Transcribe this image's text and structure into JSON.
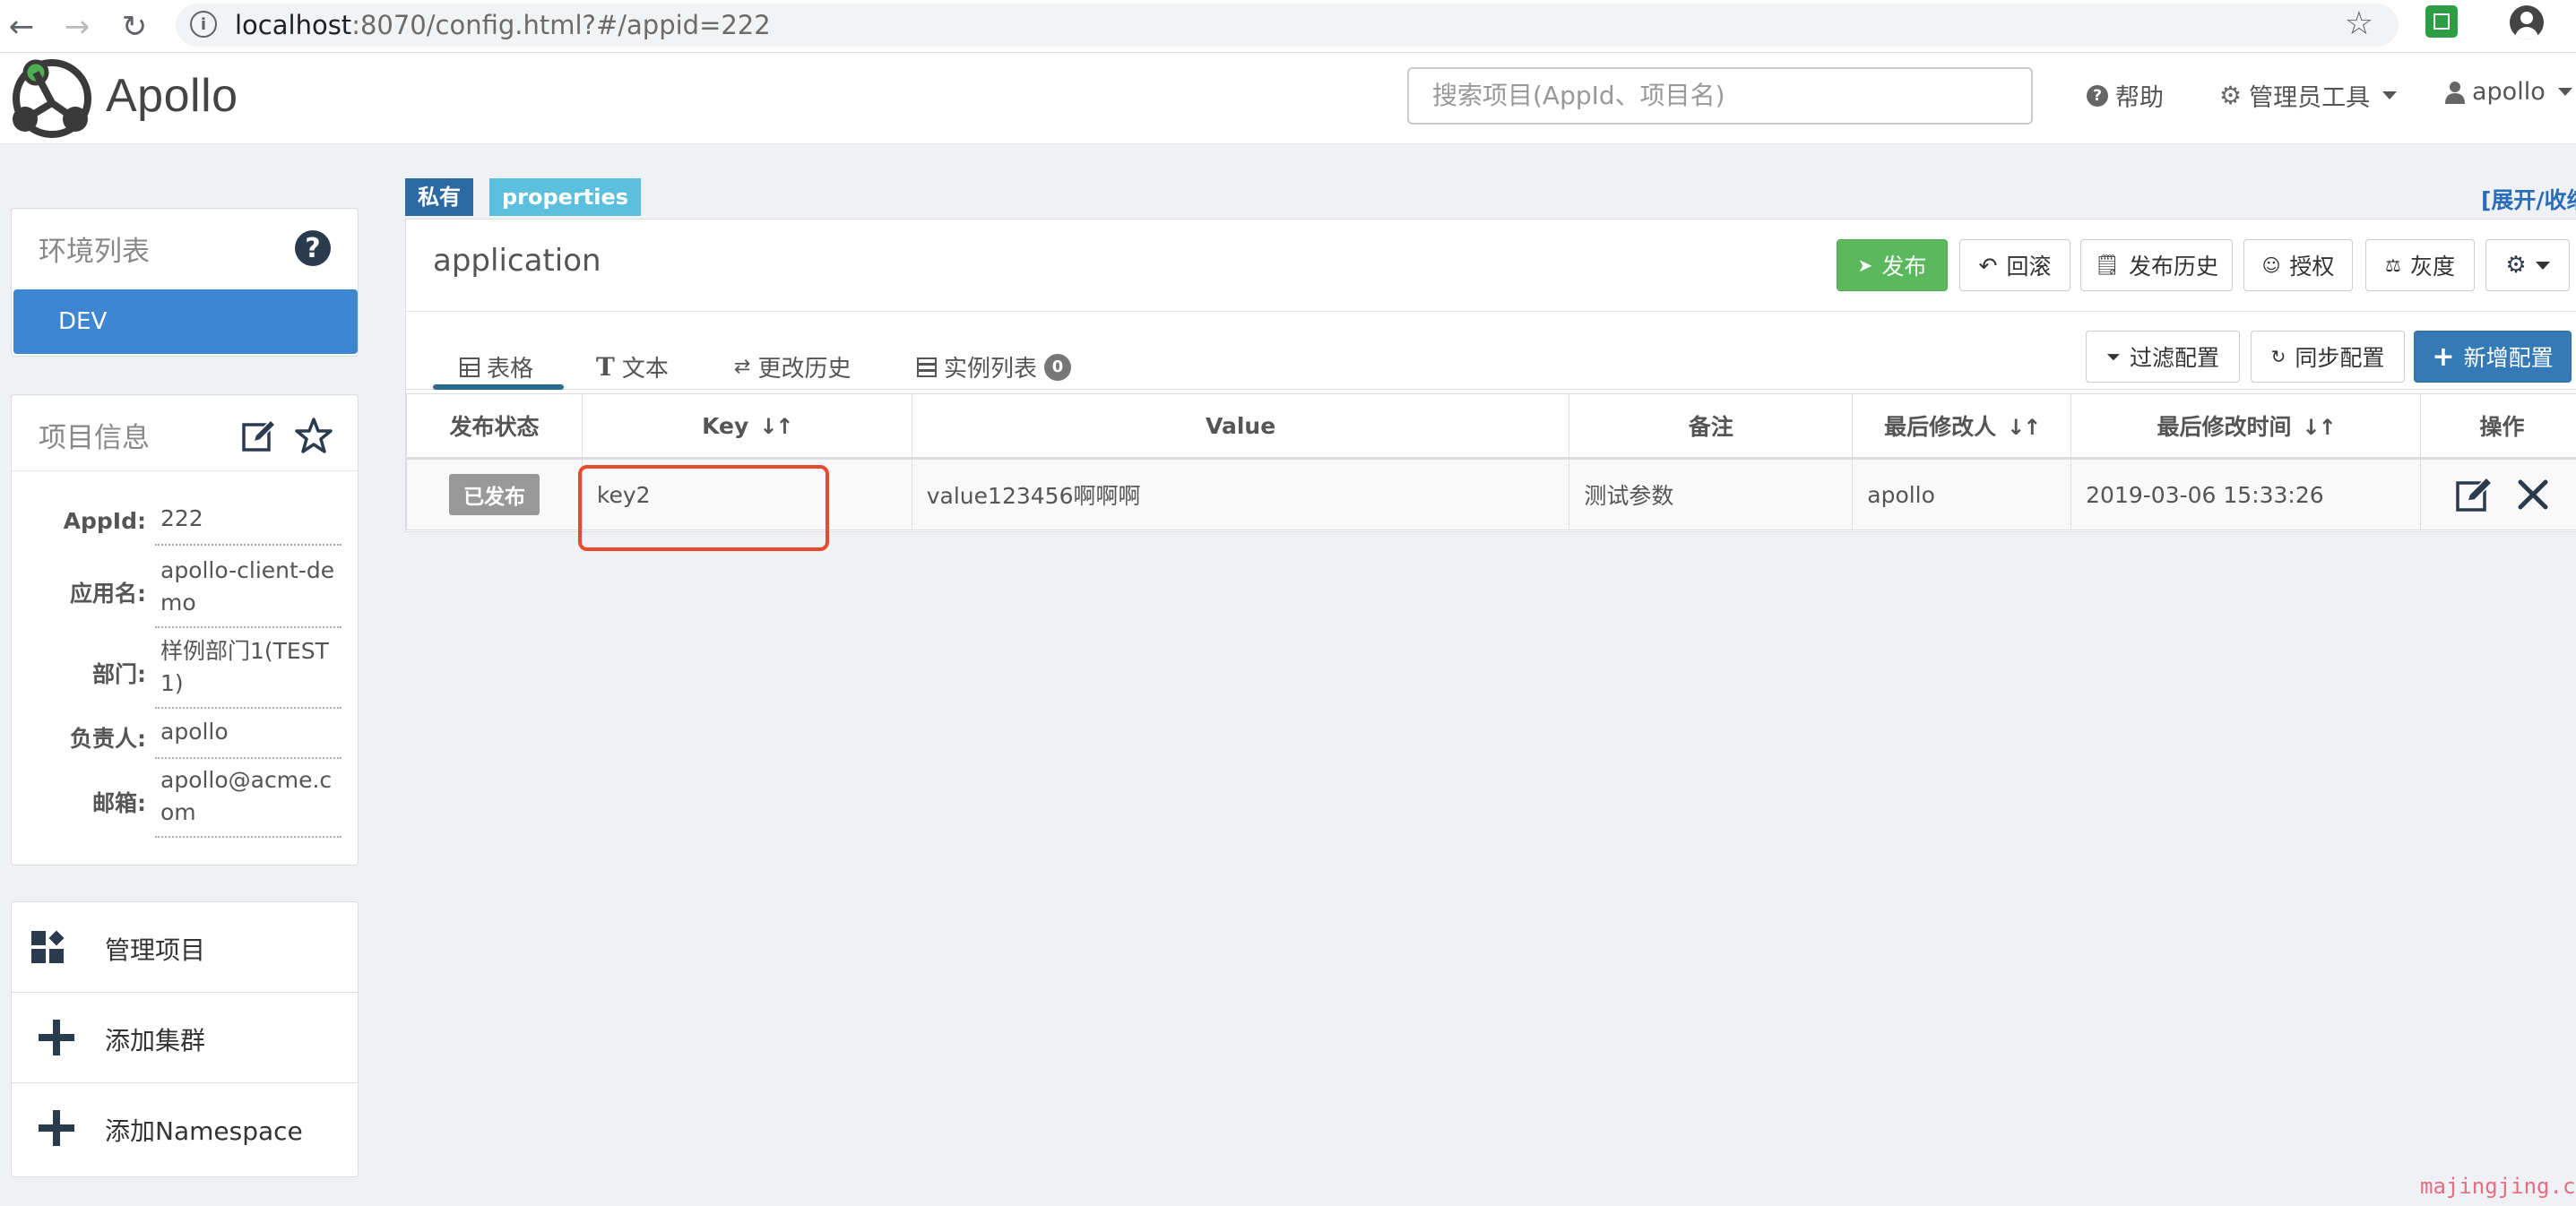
{
  "browser": {
    "url_host": "localhost",
    "url_rest": ":8070/config.html?#/appid=222"
  },
  "header": {
    "brand": "Apollo",
    "search_placeholder": "搜索项目(AppId、项目名)",
    "help": "帮助",
    "admin_tools": "管理员工具",
    "user": "apollo"
  },
  "env_panel": {
    "title": "环境列表",
    "items": [
      "DEV"
    ]
  },
  "project_panel": {
    "title": "项目信息",
    "fields": [
      {
        "label": "AppId:",
        "value": "222"
      },
      {
        "label": "应用名:",
        "value": "apollo-client-demo"
      },
      {
        "label": "部门:",
        "value": "样例部门1(TEST1)"
      },
      {
        "label": "负责人:",
        "value": "apollo"
      },
      {
        "label": "邮箱:",
        "value": "apollo@acme.com"
      }
    ]
  },
  "actions": [
    {
      "label": "管理项目",
      "icon": "dashboard-icon"
    },
    {
      "label": "添加集群",
      "icon": "plus-icon"
    },
    {
      "label": "添加Namespace",
      "icon": "plus-icon"
    }
  ],
  "namespace": {
    "tag_private": "私有",
    "tag_format": "properties",
    "expand_toggle": "[展开/收缩]",
    "name": "application",
    "buttons": {
      "publish": "发布",
      "rollback": "回滚",
      "history": "发布历史",
      "grant": "授权",
      "gray": "灰度",
      "filter": "过滤配置",
      "sync": "同步配置",
      "add": "新增配置"
    },
    "tabs": [
      "表格",
      "文本",
      "更改历史",
      "实例列表"
    ],
    "instance_count": "0",
    "table": {
      "columns": [
        "发布状态",
        "Key",
        "Value",
        "备注",
        "最后修改人",
        "最后修改时间",
        "操作"
      ],
      "rows": [
        {
          "status": "已发布",
          "key": "key2",
          "value": "value123456啊啊啊",
          "comment": "测试参数",
          "modifier": "apollo",
          "time": "2019-03-06 15:33:26"
        }
      ]
    }
  },
  "watermark": "majingjing.cn",
  "colors": {
    "primary": "#337ab7",
    "success": "#5cb85c",
    "env_active": "#3c86d2",
    "highlight": "#e8492f"
  }
}
